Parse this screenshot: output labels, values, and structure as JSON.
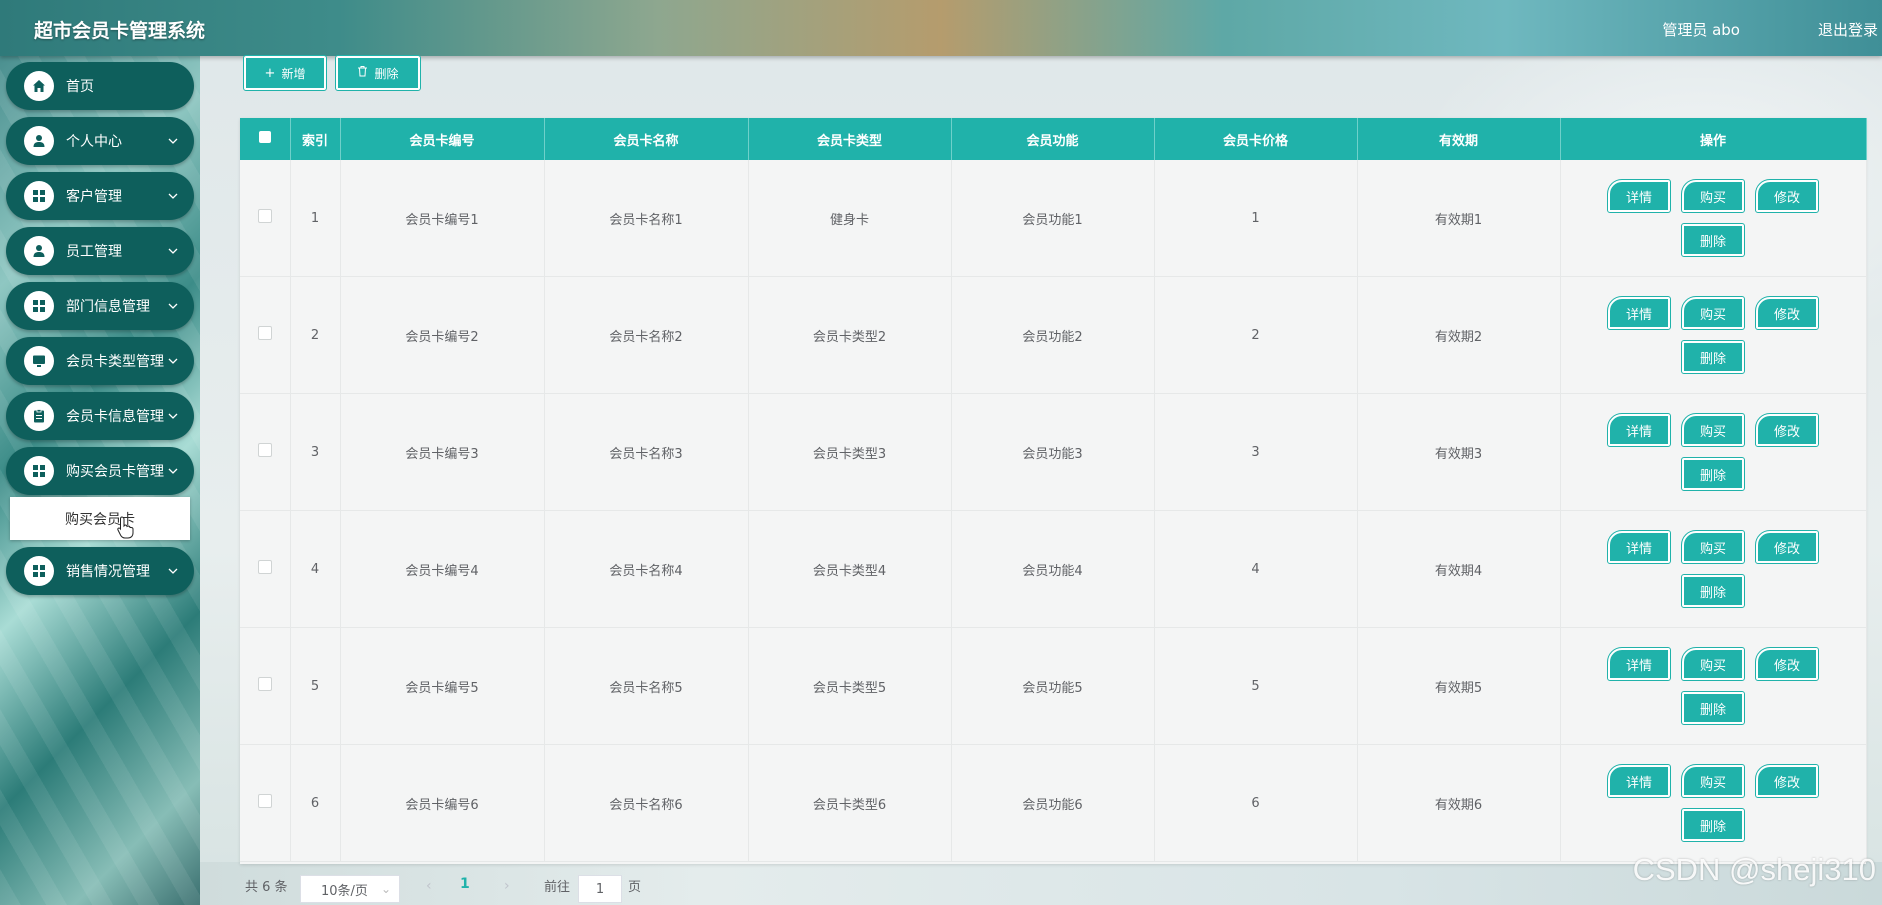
{
  "header": {
    "title": "超市会员卡管理系统",
    "admin": "管理员 abo",
    "logout": "退出登录"
  },
  "sidebar": {
    "items": [
      {
        "label": "首页",
        "icon": "home-icon",
        "chevron": false
      },
      {
        "label": "个人中心",
        "icon": "person-icon",
        "chevron": true
      },
      {
        "label": "客户管理",
        "icon": "grid-icon",
        "chevron": true
      },
      {
        "label": "员工管理",
        "icon": "person-icon",
        "chevron": true
      },
      {
        "label": "部门信息管理",
        "icon": "grid-icon",
        "chevron": true
      },
      {
        "label": "会员卡类型管理",
        "icon": "monitor-icon",
        "chevron": true
      },
      {
        "label": "会员卡信息管理",
        "icon": "clipboard-icon",
        "chevron": true
      },
      {
        "label": "购买会员卡管理",
        "icon": "grid-icon",
        "chevron": true
      },
      {
        "label": "销售情况管理",
        "icon": "grid-icon",
        "chevron": true
      }
    ],
    "submenu": "购买会员卡"
  },
  "toolbar": {
    "add": "新增",
    "delete": "删除"
  },
  "table": {
    "columns": [
      "索引",
      "会员卡编号",
      "会员卡名称",
      "会员卡类型",
      "会员功能",
      "会员卡价格",
      "有效期",
      "操作"
    ],
    "rows": [
      {
        "index": "1",
        "code": "会员卡编号1",
        "name": "会员卡名称1",
        "type": "健身卡",
        "feature": "会员功能1",
        "price": "1",
        "validity": "有效期1"
      },
      {
        "index": "2",
        "code": "会员卡编号2",
        "name": "会员卡名称2",
        "type": "会员卡类型2",
        "feature": "会员功能2",
        "price": "2",
        "validity": "有效期2"
      },
      {
        "index": "3",
        "code": "会员卡编号3",
        "name": "会员卡名称3",
        "type": "会员卡类型3",
        "feature": "会员功能3",
        "price": "3",
        "validity": "有效期3"
      },
      {
        "index": "4",
        "code": "会员卡编号4",
        "name": "会员卡名称4",
        "type": "会员卡类型4",
        "feature": "会员功能4",
        "price": "4",
        "validity": "有效期4"
      },
      {
        "index": "5",
        "code": "会员卡编号5",
        "name": "会员卡名称5",
        "type": "会员卡类型5",
        "feature": "会员功能5",
        "price": "5",
        "validity": "有效期5"
      },
      {
        "index": "6",
        "code": "会员卡编号6",
        "name": "会员卡名称6",
        "type": "会员卡类型6",
        "feature": "会员功能6",
        "price": "6",
        "validity": "有效期6"
      }
    ],
    "actions": {
      "detail": "详情",
      "buy": "购买",
      "edit": "修改",
      "delete": "删除"
    }
  },
  "pagination": {
    "total": "共 6 条",
    "page_size": "10条/页",
    "current": "1",
    "goto_prefix": "前往",
    "goto_value": "1",
    "goto_suffix": "页"
  },
  "watermark": "CSDN @sheji310",
  "colors": {
    "accent": "#20b2aa",
    "sidebar": "#0e5f5c"
  }
}
